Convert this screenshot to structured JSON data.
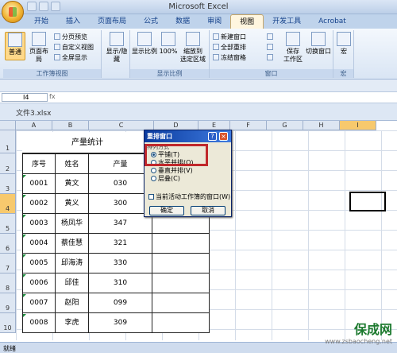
{
  "window": {
    "title": "Microsoft Excel"
  },
  "tabs": [
    "开始",
    "插入",
    "页面布局",
    "公式",
    "数据",
    "审阅",
    "视图",
    "开发工具",
    "Acrobat"
  ],
  "active_tab": "视图",
  "ribbon": {
    "workbook_views": {
      "label": "工作簿视图",
      "normal": "普通",
      "page_layout": "页面布局",
      "page_break": "分页预览",
      "custom_views": "自定义视图",
      "full_screen": "全屏显示"
    },
    "show_hide": {
      "label": "显示/隐藏"
    },
    "zoom": {
      "label": "显示比例",
      "zoom": "显示比例",
      "hundred": "100%",
      "zoom_selection_l1": "缩放到",
      "zoom_selection_l2": "选定区域"
    },
    "window": {
      "label": "窗口",
      "new_window": "新建窗口",
      "arrange_all": "全部重排",
      "freeze": "冻结窗格",
      "save_workspace": "保存",
      "save_workspace_2": "工作区",
      "switch_windows": "切换窗口"
    },
    "macros": {
      "label": "宏",
      "macros": "宏"
    }
  },
  "name_box": "I4",
  "formula_icon": "fx",
  "document": {
    "name": "文件3.xlsx"
  },
  "columns": [
    "A",
    "B",
    "C",
    "D",
    "E",
    "F",
    "G",
    "H",
    "I"
  ],
  "selected_column": "I",
  "rows": [
    "1",
    "2",
    "3",
    "4",
    "5",
    "6",
    "7",
    "8",
    "9",
    "10"
  ],
  "selected_row": "4",
  "sheet": {
    "title": "产量统计",
    "headers": [
      "序号",
      "姓名",
      "产量"
    ],
    "records": [
      [
        "0001",
        "黄文",
        "030"
      ],
      [
        "0002",
        "黄义",
        "300"
      ],
      [
        "0003",
        "杨凤华",
        "347"
      ],
      [
        "0004",
        "蔡佳慧",
        "321"
      ],
      [
        "0005",
        "邱海涛",
        "330"
      ],
      [
        "0006",
        "邱佳",
        "310"
      ],
      [
        "0007",
        "赵阳",
        "099"
      ],
      [
        "0008",
        "李虎",
        "309"
      ]
    ]
  },
  "dialog": {
    "title": "重排窗口",
    "help": "?",
    "close": "×",
    "group_label": "排列方式",
    "options": [
      "平铺(T)",
      "水平并排(O)",
      "垂直并排(V)",
      "层叠(C)"
    ],
    "selected_option": 0,
    "checkbox": "当前活动工作簿的窗口(W)",
    "ok": "确定",
    "cancel": "取消"
  },
  "status": {
    "text": "就绪"
  },
  "watermark": {
    "logo": "保成网",
    "url": "www.zsbaocheng.net"
  },
  "colors": {
    "highlight": "#c0282b",
    "title_bar": "#0a3b9e"
  }
}
